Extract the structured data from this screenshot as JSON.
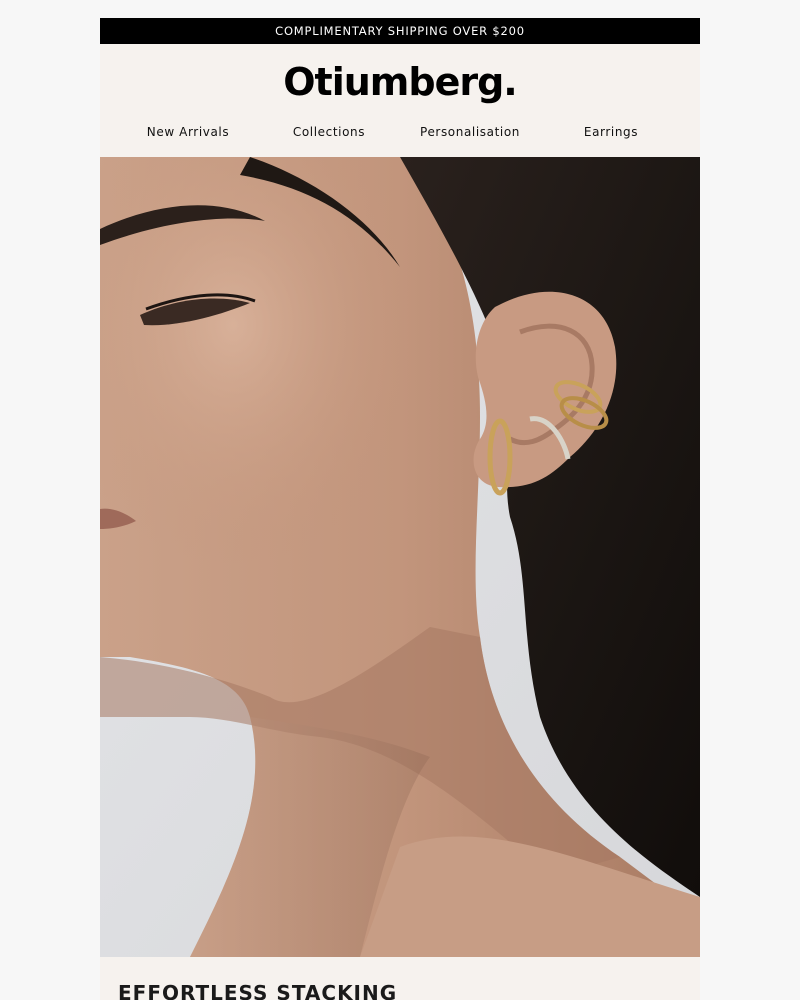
{
  "promo": {
    "text": "COMPLIMENTARY SHIPPING OVER $200"
  },
  "brand": {
    "logo_text": "Otiumberg."
  },
  "nav": {
    "items": [
      {
        "label": "New Arrivals"
      },
      {
        "label": "Collections"
      },
      {
        "label": "Personalisation"
      },
      {
        "label": "Earrings"
      }
    ]
  },
  "hero": {
    "subject": "woman-profile-wearing-gold-ear-cuffs"
  },
  "section": {
    "title": "EFFORTLESS STACKING"
  },
  "colors": {
    "promo_bg": "#000000",
    "promo_text": "#ffffff",
    "header_bg": "#f6f2ee",
    "page_bg": "#f7f7f7",
    "gold": "#c9a25a"
  }
}
